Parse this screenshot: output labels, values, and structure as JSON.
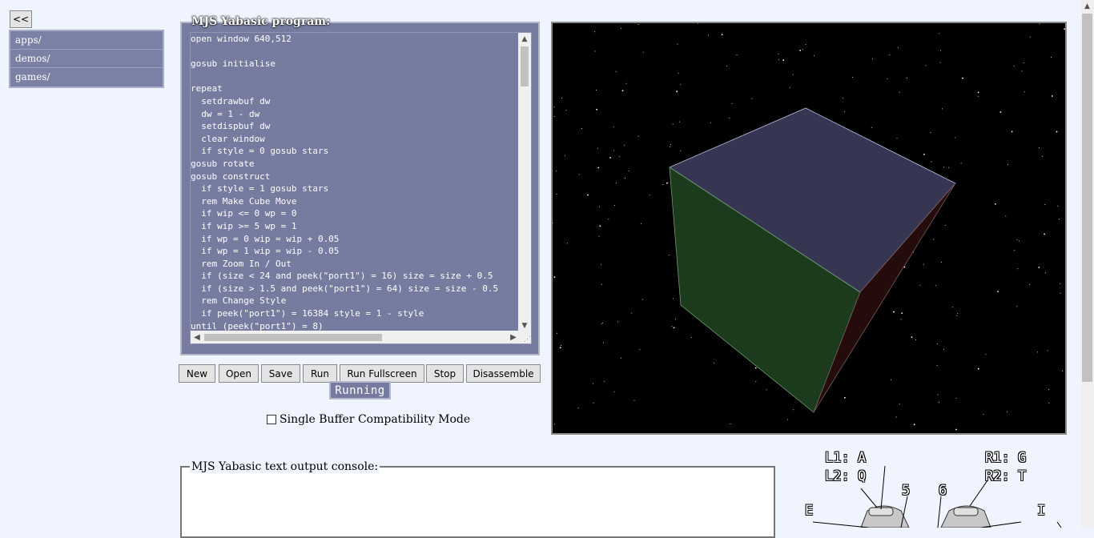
{
  "nav": {
    "back_label": "<<"
  },
  "files": [
    {
      "label": "apps/"
    },
    {
      "label": "demos/"
    },
    {
      "label": "games/"
    }
  ],
  "program": {
    "legend": "MJS Yabasic program:",
    "code": "open window 640,512\n\ngosub initialise\n\nrepeat\n  setdrawbuf dw\n  dw = 1 - dw\n  setdispbuf dw\n  clear window\n  if style = 0 gosub stars\ngosub rotate\ngosub construct\n  if style = 1 gosub stars\n  rem Make Cube Move\n  if wip <= 0 wp = 0\n  if wip >= 5 wp = 1\n  if wp = 0 wip = wip + 0.05\n  if wp = 1 wip = wip - 0.05\n  rem Zoom In / Out\n  if (size < 24 and peek(\"port1\") = 16) size = size + 0.5\n  if (size > 1.5 and peek(\"port1\") = 64) size = size - 0.5\n  rem Change Style\n  if peek(\"port1\") = 16384 style = 1 - style\nuntil (peek(\"port1\") = 8)"
  },
  "toolbar": {
    "new_label": "New",
    "open_label": "Open",
    "save_label": "Save",
    "run_label": "Run",
    "run_fullscreen_label": "Run Fullscreen",
    "stop_label": "Stop",
    "disassemble_label": "Disassemble"
  },
  "status": {
    "text": "Running"
  },
  "options": {
    "single_buffer_label": "Single Buffer Compatibility Mode",
    "single_buffer_checked": false
  },
  "console": {
    "legend": "MJS Yabasic text output console:"
  },
  "gamepad": {
    "l1": "L1: A",
    "l2": "L2: Q",
    "r1": "R1: G",
    "r2": "R2: T",
    "btn5": "5",
    "btn6": "6",
    "e": "E",
    "i": "I"
  },
  "colors": {
    "cube_top": "#363652",
    "cube_left": "#1b3b1c",
    "cube_right": "#240c0c",
    "panel": "#757ca0"
  }
}
